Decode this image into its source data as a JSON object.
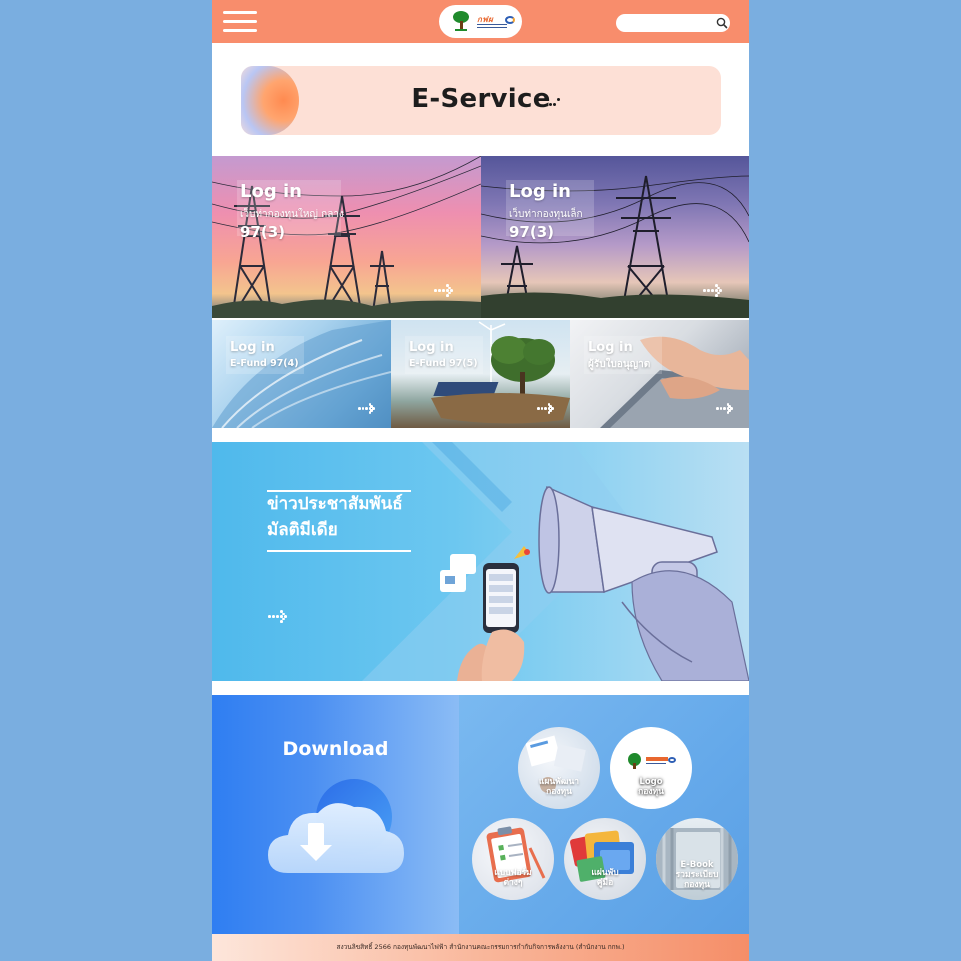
{
  "header": {
    "logo_text": "กฟผ",
    "search": {
      "placeholder": ""
    }
  },
  "eservice": {
    "title": "E-Service"
  },
  "tiles": [
    {
      "login": "Log in",
      "subtitle": "เว็บท่ากองทุนใหญ่ กลาง",
      "code": "97(3)"
    },
    {
      "login": "Log in",
      "subtitle": "เว็บท่ากองทุนเล็ก",
      "code": "97(3)"
    },
    {
      "login": "Log in",
      "subtitle": "E-Fund 97(4)"
    },
    {
      "login": "Log in",
      "subtitle": "E-Fund 97(5)"
    },
    {
      "login": "Log in",
      "subtitle": "ผู้รับใบอนุญาต"
    }
  ],
  "news": {
    "title_line1": "ข่าวประชาสัมพันธ์",
    "title_line2": "มัลติมีเดีย"
  },
  "download": {
    "title": "Download",
    "items": [
      {
        "line1": "แผนพัฒนา",
        "line2": "กองทุน"
      },
      {
        "line1": "Logo",
        "line2": "กองทุน"
      },
      {
        "line1": "แบบฟอร์ม",
        "line2": "ต่างๆ"
      },
      {
        "line1": "แผ่นพับ",
        "line2": "คู่มือ"
      },
      {
        "line1": "E-Book",
        "line2": "รวมระเบียบ",
        "line3": "กองทุน"
      }
    ]
  },
  "footer": {
    "text": "สงวนลิขสิทธิ์ 2566 กองทุนพัฒนาไฟฟ้า สำนักงานคณะกรรมการกำกับกิจการพลังงาน (สำนักงาน กกพ.)"
  },
  "colors": {
    "accent": "#f88d6c",
    "background": "#7aaee0",
    "download_blue": "#2f7ef2"
  }
}
